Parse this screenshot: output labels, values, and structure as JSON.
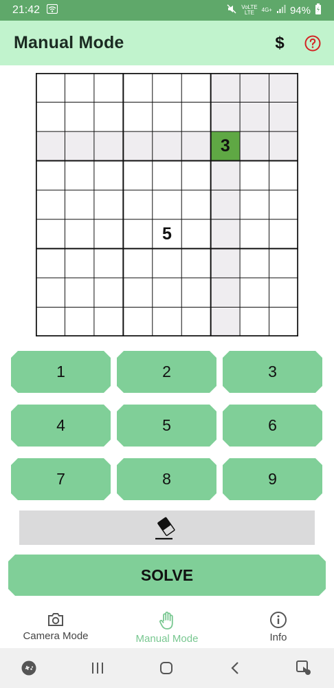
{
  "status_bar": {
    "time": "21:42",
    "network_label": "VoLTE",
    "network_sub": "LTE",
    "data_label": "4G+",
    "battery": "94%"
  },
  "app_bar": {
    "title": "Manual Mode",
    "donate_symbol": "$",
    "help_icon": "help-circle-icon"
  },
  "board": {
    "rows": 9,
    "cols": 9,
    "selected": {
      "row": 3,
      "col": 7,
      "value": "3"
    },
    "givens": [
      {
        "row": 3,
        "col": 7,
        "value": "3"
      },
      {
        "row": 6,
        "col": 5,
        "value": "5"
      }
    ],
    "highlight_color": "#efedf0",
    "selected_color": "#5fa844"
  },
  "keypad": {
    "keys": [
      "1",
      "2",
      "3",
      "4",
      "5",
      "6",
      "7",
      "8",
      "9"
    ],
    "erase_icon": "eraser-icon",
    "solve_label": "SOLVE"
  },
  "bottom_nav": {
    "items": [
      {
        "label": "Camera Mode",
        "icon": "camera-icon",
        "active": false
      },
      {
        "label": "Manual Mode",
        "icon": "hand-icon",
        "active": true
      },
      {
        "label": "Info",
        "icon": "info-icon",
        "active": false
      }
    ]
  },
  "system_nav": {
    "items": [
      "game-launcher-icon",
      "recents-icon",
      "home-icon",
      "back-icon",
      "assistant-icon"
    ]
  },
  "colors": {
    "status_bar": "#5fa86a",
    "app_bar": "#c1f3cd",
    "button": "#80cf98",
    "active_nav": "#78c790"
  }
}
